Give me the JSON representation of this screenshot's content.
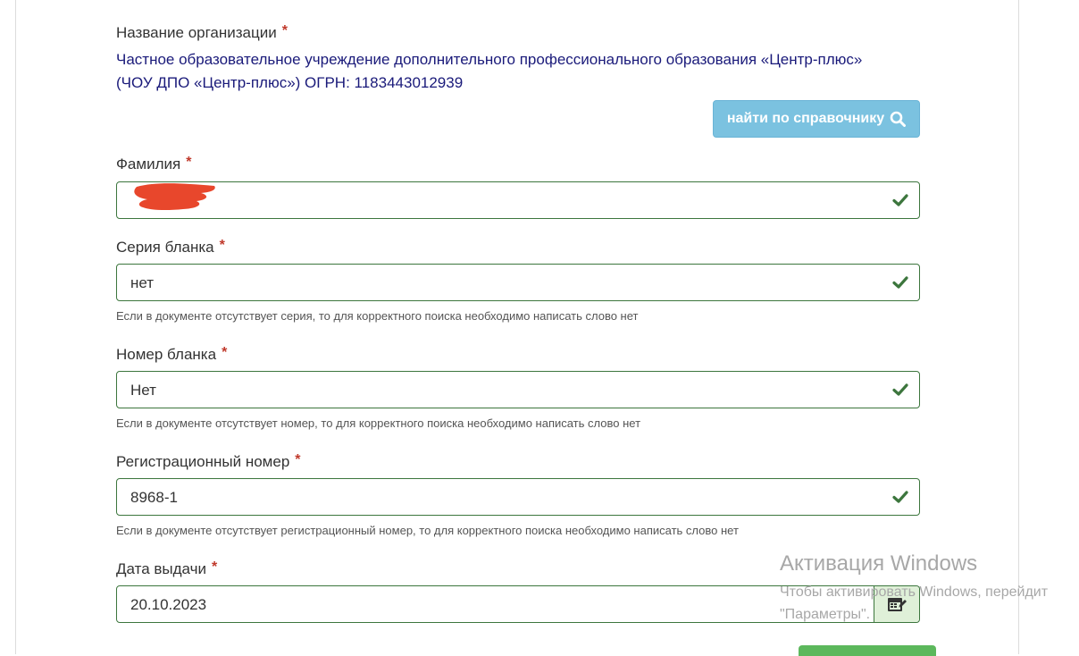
{
  "organization": {
    "label": "Название организации",
    "required_mark": "*",
    "value_line1": "Частное образовательное учреждение дополнительного профессионального образования «Центр-плюс»",
    "value_line2": "(ЧОУ ДПО «Центр-плюс») ОГРН: 1183443012939",
    "lookup_button_label": "найти по справочнику",
    "lookup_icon": "search-icon"
  },
  "surname": {
    "label": "Фамилия",
    "required_mark": "*",
    "value": "",
    "status_icon": "check-icon"
  },
  "form_series": {
    "label": "Серия бланка",
    "required_mark": "*",
    "value": "нет",
    "help": "Если в документе отсутствует серия, то для корректного поиска необходимо написать слово нет",
    "status_icon": "check-icon"
  },
  "form_number": {
    "label": "Номер бланка",
    "required_mark": "*",
    "value": "Нет",
    "help": "Если в документе отсутствует номер, то для корректного поиска необходимо написать слово нет",
    "status_icon": "check-icon"
  },
  "registration_number": {
    "label": "Регистрационный номер",
    "required_mark": "*",
    "value": "8968-1",
    "help": "Если в документе отсутствует регистрационный номер, то для корректного поиска необходимо написать слово нет",
    "status_icon": "check-icon"
  },
  "issue_date": {
    "label": "Дата выдачи",
    "required_mark": "*",
    "value": "20.10.2023",
    "calendar_icon": "calendar-edit-icon"
  },
  "watermark": {
    "title": "Активация Windows",
    "line1": "Чтобы активировать Windows, перейдит",
    "line2": "\"Параметры\"."
  },
  "colors": {
    "success": "#3c763d",
    "info_button": "#7bc2e0",
    "org_text": "#1a1a7a",
    "required": "#c0392b",
    "redaction": "#e8472c"
  }
}
